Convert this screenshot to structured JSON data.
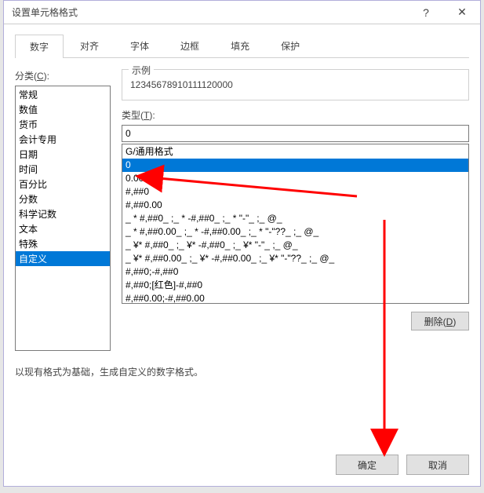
{
  "titlebar": {
    "title": "设置单元格格式",
    "help": "?",
    "close": "✕"
  },
  "tabs": [
    "数字",
    "对齐",
    "字体",
    "边框",
    "填充",
    "保护"
  ],
  "active_tab": 0,
  "category": {
    "label_prefix": "分类(",
    "label_key": "C",
    "label_suffix": "):",
    "items": [
      "常规",
      "数值",
      "货币",
      "会计专用",
      "日期",
      "时间",
      "百分比",
      "分数",
      "科学记数",
      "文本",
      "特殊",
      "自定义"
    ],
    "selected": 11
  },
  "example": {
    "legend": "示例",
    "value": "12345678910111120000"
  },
  "type": {
    "label_prefix": "类型(",
    "label_key": "T",
    "label_suffix": "):",
    "input_value": "0",
    "items": [
      "G/通用格式",
      "0",
      "0.00",
      "#,##0",
      "#,##0.00",
      "_ * #,##0_ ;_ * -#,##0_ ;_ * \"-\"_ ;_ @_ ",
      "_ * #,##0.00_ ;_ * -#,##0.00_ ;_ * \"-\"??_ ;_ @_ ",
      "_ ¥* #,##0_ ;_ ¥* -#,##0_ ;_ ¥* \"-\"_ ;_ @_ ",
      "_ ¥* #,##0.00_ ;_ ¥* -#,##0.00_ ;_ ¥* \"-\"??_ ;_ @_ ",
      "#,##0;-#,##0",
      "#,##0;[红色]-#,##0",
      "#,##0.00;-#,##0.00"
    ],
    "selected": 1
  },
  "delete": {
    "label_prefix": "删除(",
    "label_key": "D",
    "label_suffix": ")"
  },
  "hint": "以现有格式为基础，生成自定义的数字格式。",
  "footer": {
    "ok": "确定",
    "cancel": "取消"
  },
  "colors": {
    "selection": "#0078d7",
    "arrow": "#ff0000"
  }
}
